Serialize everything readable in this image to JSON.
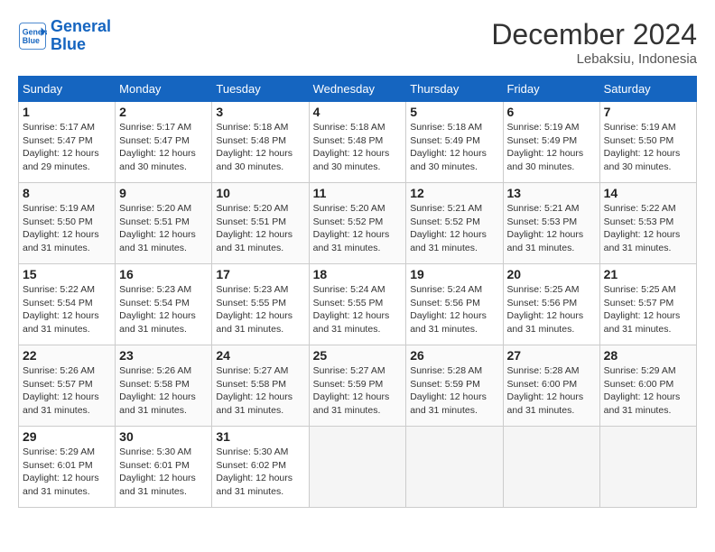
{
  "logo": {
    "line1": "General",
    "line2": "Blue"
  },
  "title": "December 2024",
  "location": "Lebaksiu, Indonesia",
  "days_header": [
    "Sunday",
    "Monday",
    "Tuesday",
    "Wednesday",
    "Thursday",
    "Friday",
    "Saturday"
  ],
  "weeks": [
    [
      {
        "day": "1",
        "info": "Sunrise: 5:17 AM\nSunset: 5:47 PM\nDaylight: 12 hours\nand 29 minutes."
      },
      {
        "day": "2",
        "info": "Sunrise: 5:17 AM\nSunset: 5:47 PM\nDaylight: 12 hours\nand 30 minutes."
      },
      {
        "day": "3",
        "info": "Sunrise: 5:18 AM\nSunset: 5:48 PM\nDaylight: 12 hours\nand 30 minutes."
      },
      {
        "day": "4",
        "info": "Sunrise: 5:18 AM\nSunset: 5:48 PM\nDaylight: 12 hours\nand 30 minutes."
      },
      {
        "day": "5",
        "info": "Sunrise: 5:18 AM\nSunset: 5:49 PM\nDaylight: 12 hours\nand 30 minutes."
      },
      {
        "day": "6",
        "info": "Sunrise: 5:19 AM\nSunset: 5:49 PM\nDaylight: 12 hours\nand 30 minutes."
      },
      {
        "day": "7",
        "info": "Sunrise: 5:19 AM\nSunset: 5:50 PM\nDaylight: 12 hours\nand 30 minutes."
      }
    ],
    [
      {
        "day": "8",
        "info": "Sunrise: 5:19 AM\nSunset: 5:50 PM\nDaylight: 12 hours\nand 31 minutes."
      },
      {
        "day": "9",
        "info": "Sunrise: 5:20 AM\nSunset: 5:51 PM\nDaylight: 12 hours\nand 31 minutes."
      },
      {
        "day": "10",
        "info": "Sunrise: 5:20 AM\nSunset: 5:51 PM\nDaylight: 12 hours\nand 31 minutes."
      },
      {
        "day": "11",
        "info": "Sunrise: 5:20 AM\nSunset: 5:52 PM\nDaylight: 12 hours\nand 31 minutes."
      },
      {
        "day": "12",
        "info": "Sunrise: 5:21 AM\nSunset: 5:52 PM\nDaylight: 12 hours\nand 31 minutes."
      },
      {
        "day": "13",
        "info": "Sunrise: 5:21 AM\nSunset: 5:53 PM\nDaylight: 12 hours\nand 31 minutes."
      },
      {
        "day": "14",
        "info": "Sunrise: 5:22 AM\nSunset: 5:53 PM\nDaylight: 12 hours\nand 31 minutes."
      }
    ],
    [
      {
        "day": "15",
        "info": "Sunrise: 5:22 AM\nSunset: 5:54 PM\nDaylight: 12 hours\nand 31 minutes."
      },
      {
        "day": "16",
        "info": "Sunrise: 5:23 AM\nSunset: 5:54 PM\nDaylight: 12 hours\nand 31 minutes."
      },
      {
        "day": "17",
        "info": "Sunrise: 5:23 AM\nSunset: 5:55 PM\nDaylight: 12 hours\nand 31 minutes."
      },
      {
        "day": "18",
        "info": "Sunrise: 5:24 AM\nSunset: 5:55 PM\nDaylight: 12 hours\nand 31 minutes."
      },
      {
        "day": "19",
        "info": "Sunrise: 5:24 AM\nSunset: 5:56 PM\nDaylight: 12 hours\nand 31 minutes."
      },
      {
        "day": "20",
        "info": "Sunrise: 5:25 AM\nSunset: 5:56 PM\nDaylight: 12 hours\nand 31 minutes."
      },
      {
        "day": "21",
        "info": "Sunrise: 5:25 AM\nSunset: 5:57 PM\nDaylight: 12 hours\nand 31 minutes."
      }
    ],
    [
      {
        "day": "22",
        "info": "Sunrise: 5:26 AM\nSunset: 5:57 PM\nDaylight: 12 hours\nand 31 minutes."
      },
      {
        "day": "23",
        "info": "Sunrise: 5:26 AM\nSunset: 5:58 PM\nDaylight: 12 hours\nand 31 minutes."
      },
      {
        "day": "24",
        "info": "Sunrise: 5:27 AM\nSunset: 5:58 PM\nDaylight: 12 hours\nand 31 minutes."
      },
      {
        "day": "25",
        "info": "Sunrise: 5:27 AM\nSunset: 5:59 PM\nDaylight: 12 hours\nand 31 minutes."
      },
      {
        "day": "26",
        "info": "Sunrise: 5:28 AM\nSunset: 5:59 PM\nDaylight: 12 hours\nand 31 minutes."
      },
      {
        "day": "27",
        "info": "Sunrise: 5:28 AM\nSunset: 6:00 PM\nDaylight: 12 hours\nand 31 minutes."
      },
      {
        "day": "28",
        "info": "Sunrise: 5:29 AM\nSunset: 6:00 PM\nDaylight: 12 hours\nand 31 minutes."
      }
    ],
    [
      {
        "day": "29",
        "info": "Sunrise: 5:29 AM\nSunset: 6:01 PM\nDaylight: 12 hours\nand 31 minutes."
      },
      {
        "day": "30",
        "info": "Sunrise: 5:30 AM\nSunset: 6:01 PM\nDaylight: 12 hours\nand 31 minutes."
      },
      {
        "day": "31",
        "info": "Sunrise: 5:30 AM\nSunset: 6:02 PM\nDaylight: 12 hours\nand 31 minutes."
      },
      null,
      null,
      null,
      null
    ]
  ]
}
